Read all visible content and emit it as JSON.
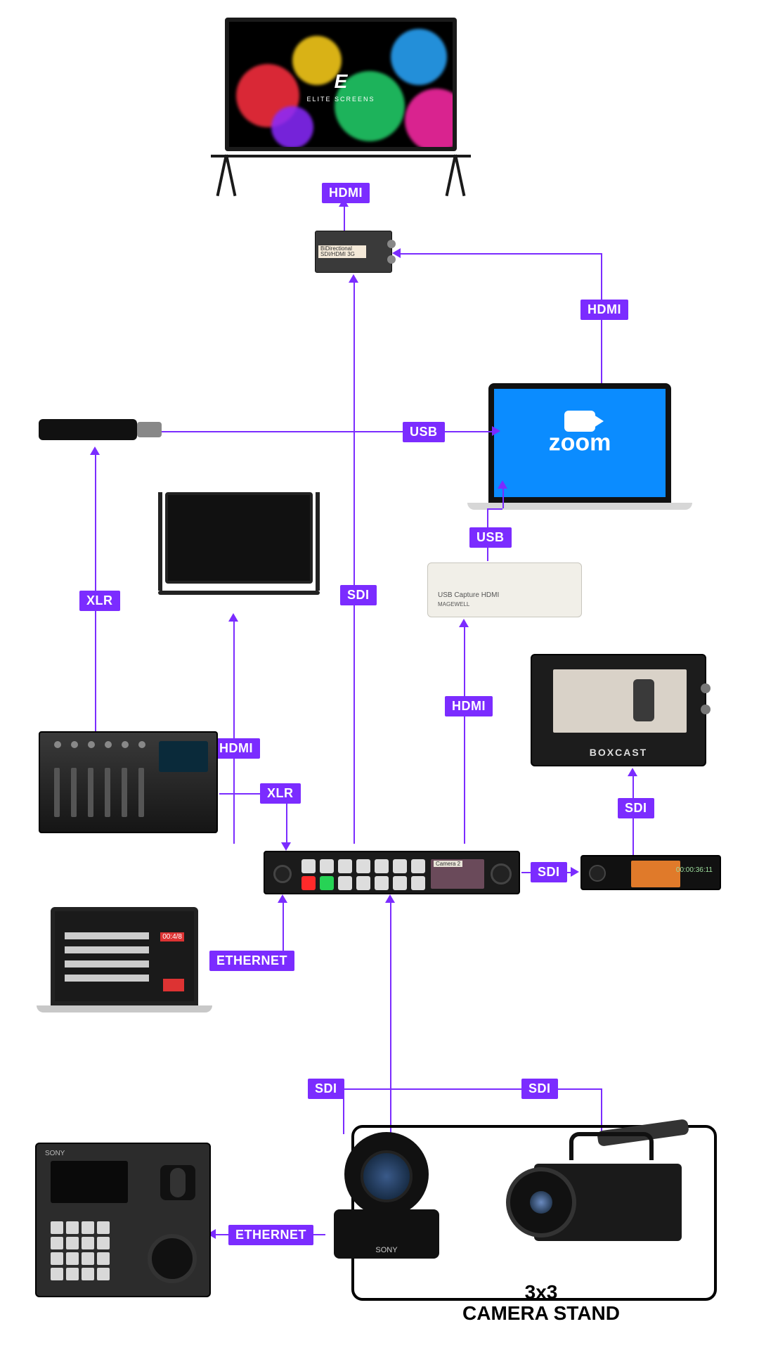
{
  "labels": {
    "hdmi_screen": "HDMI",
    "hdmi_laptop_conv": "HDMI",
    "usb_stick": "USB",
    "usb_capture": "USB",
    "xlr_up": "XLR",
    "sdi_vert": "SDI",
    "hdmi_monitor": "HDMI",
    "xlr_mix": "XLR",
    "hdmi_capture": "HDMI",
    "sdi_boxcast": "SDI",
    "sdi_atem_rec": "SDI",
    "ethernet_ctrl": "ETHERNET",
    "sdi_cam1": "SDI",
    "sdi_cam2": "SDI",
    "ethernet_ptz": "ETHERNET"
  },
  "text": {
    "zoom": "zoom",
    "boxcast": "BOXCAST",
    "capture": "USB Capture HDMI",
    "capture_brand": "MAGEWELL",
    "conv_line": "BiDirectional\nSDI/HDMI 3G",
    "elite": "ELITE SCREENS",
    "stand_top": "3x3",
    "stand_bot": "CAMERA STAND",
    "rec_time": "00:00:36:11",
    "ctrl_rec": "00:4/8",
    "atem_tag": "Camera 2",
    "sony": "SONY"
  },
  "diagram_nodes": [
    "projection-screen",
    "sdi-hdmi-converter",
    "zoom-laptop",
    "audio-usb-adapter",
    "preview-monitor",
    "usb-capture-hdmi",
    "audio-mixer",
    "boxcast-encoder",
    "atem-switcher",
    "hyperdeck-recorder",
    "control-laptop",
    "sony-ptz-controller",
    "ptz-camera",
    "camcorder"
  ],
  "connections": [
    {
      "from": "sdi-hdmi-converter",
      "to": "projection-screen",
      "type": "HDMI"
    },
    {
      "from": "zoom-laptop",
      "to": "sdi-hdmi-converter",
      "type": "HDMI"
    },
    {
      "from": "audio-usb-adapter",
      "to": "zoom-laptop",
      "type": "USB"
    },
    {
      "from": "usb-capture-hdmi",
      "to": "zoom-laptop",
      "type": "USB"
    },
    {
      "from": "audio-mixer",
      "to": "audio-usb-adapter",
      "type": "XLR"
    },
    {
      "from": "atem-switcher",
      "to": "sdi-hdmi-converter",
      "type": "SDI"
    },
    {
      "from": "atem-switcher",
      "to": "preview-monitor",
      "type": "HDMI"
    },
    {
      "from": "audio-mixer",
      "to": "atem-switcher",
      "type": "XLR"
    },
    {
      "from": "atem-switcher",
      "to": "usb-capture-hdmi",
      "type": "HDMI"
    },
    {
      "from": "hyperdeck-recorder",
      "to": "boxcast-encoder",
      "type": "SDI"
    },
    {
      "from": "atem-switcher",
      "to": "hyperdeck-recorder",
      "type": "SDI"
    },
    {
      "from": "control-laptop",
      "to": "atem-switcher",
      "type": "ETHERNET"
    },
    {
      "from": "ptz-camera",
      "to": "atem-switcher",
      "type": "SDI"
    },
    {
      "from": "camcorder",
      "to": "atem-switcher",
      "type": "SDI"
    },
    {
      "from": "ptz-camera",
      "to": "sony-ptz-controller",
      "type": "ETHERNET"
    }
  ]
}
